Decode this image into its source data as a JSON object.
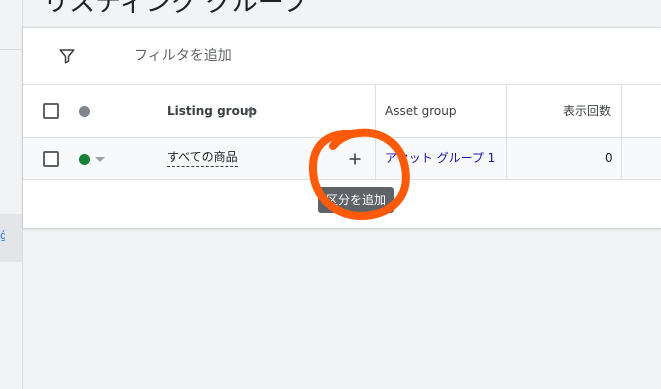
{
  "page": {
    "title": "リスティング グループ"
  },
  "filter": {
    "icon": "filter-icon",
    "label": "フィルタを追加"
  },
  "table": {
    "headers": {
      "listing_group": "Listing group",
      "asset_group": "Asset group",
      "impressions": "表示回数"
    },
    "rows": [
      {
        "listing_group": "すべての商品",
        "status_color": "#188038",
        "asset_group": "アセット グループ 1",
        "impressions": "0"
      }
    ]
  },
  "tooltip": {
    "text": "区分を追加"
  },
  "colors": {
    "header_status_dot": "#80868b",
    "link": "#1a0dab",
    "annotation": "#ff5a0a"
  }
}
